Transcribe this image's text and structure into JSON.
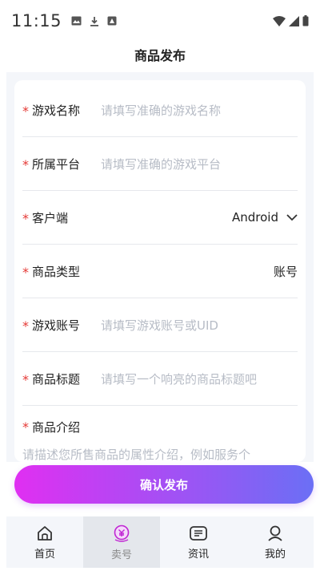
{
  "status_bar": {
    "time": "11:15"
  },
  "header": {
    "title": "商品发布"
  },
  "form": {
    "required_mark": "*",
    "fields": [
      {
        "label": "游戏名称",
        "placeholder": "请填写准确的游戏名称"
      },
      {
        "label": "所属平台",
        "placeholder": "请填写准确的游戏平台"
      },
      {
        "label": "客户端",
        "value": "Android"
      },
      {
        "label": "商品类型",
        "value": "账号"
      },
      {
        "label": "游戏账号",
        "placeholder": "请填写游戏账号或UID"
      },
      {
        "label": "商品标题",
        "placeholder": "请填写一个响亮的商品标题吧"
      },
      {
        "label": "商品介绍",
        "placeholder": "请描述您所售商品的属性介绍，例如服务个"
      }
    ]
  },
  "submit": {
    "label": "确认发布"
  },
  "tab_bar": {
    "tabs": [
      {
        "label": "首页",
        "icon": "home-icon"
      },
      {
        "label": "卖号",
        "icon": "sell-icon",
        "active": true
      },
      {
        "label": "资讯",
        "icon": "news-icon"
      },
      {
        "label": "我的",
        "icon": "profile-icon"
      }
    ]
  },
  "colors": {
    "accent_start": "#e02ff2",
    "accent_end": "#6b6ff5",
    "required": "#e53935",
    "placeholder": "#b7bcc6"
  }
}
